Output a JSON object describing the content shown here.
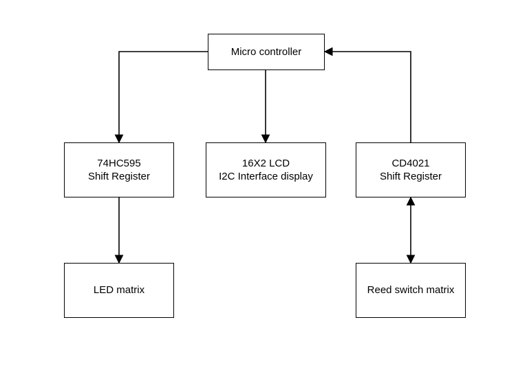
{
  "blocks": {
    "mcu": {
      "line1": "Micro controller"
    },
    "sr595": {
      "line1": "74HC595",
      "line2": "Shift Register"
    },
    "lcd": {
      "line1": "16X2 LCD",
      "line2": "I2C Interface display"
    },
    "cd4021": {
      "line1": "CD4021",
      "line2": "Shift Register"
    },
    "led": {
      "line1": "LED matrix"
    },
    "reed": {
      "line1": "Reed switch matrix"
    }
  }
}
